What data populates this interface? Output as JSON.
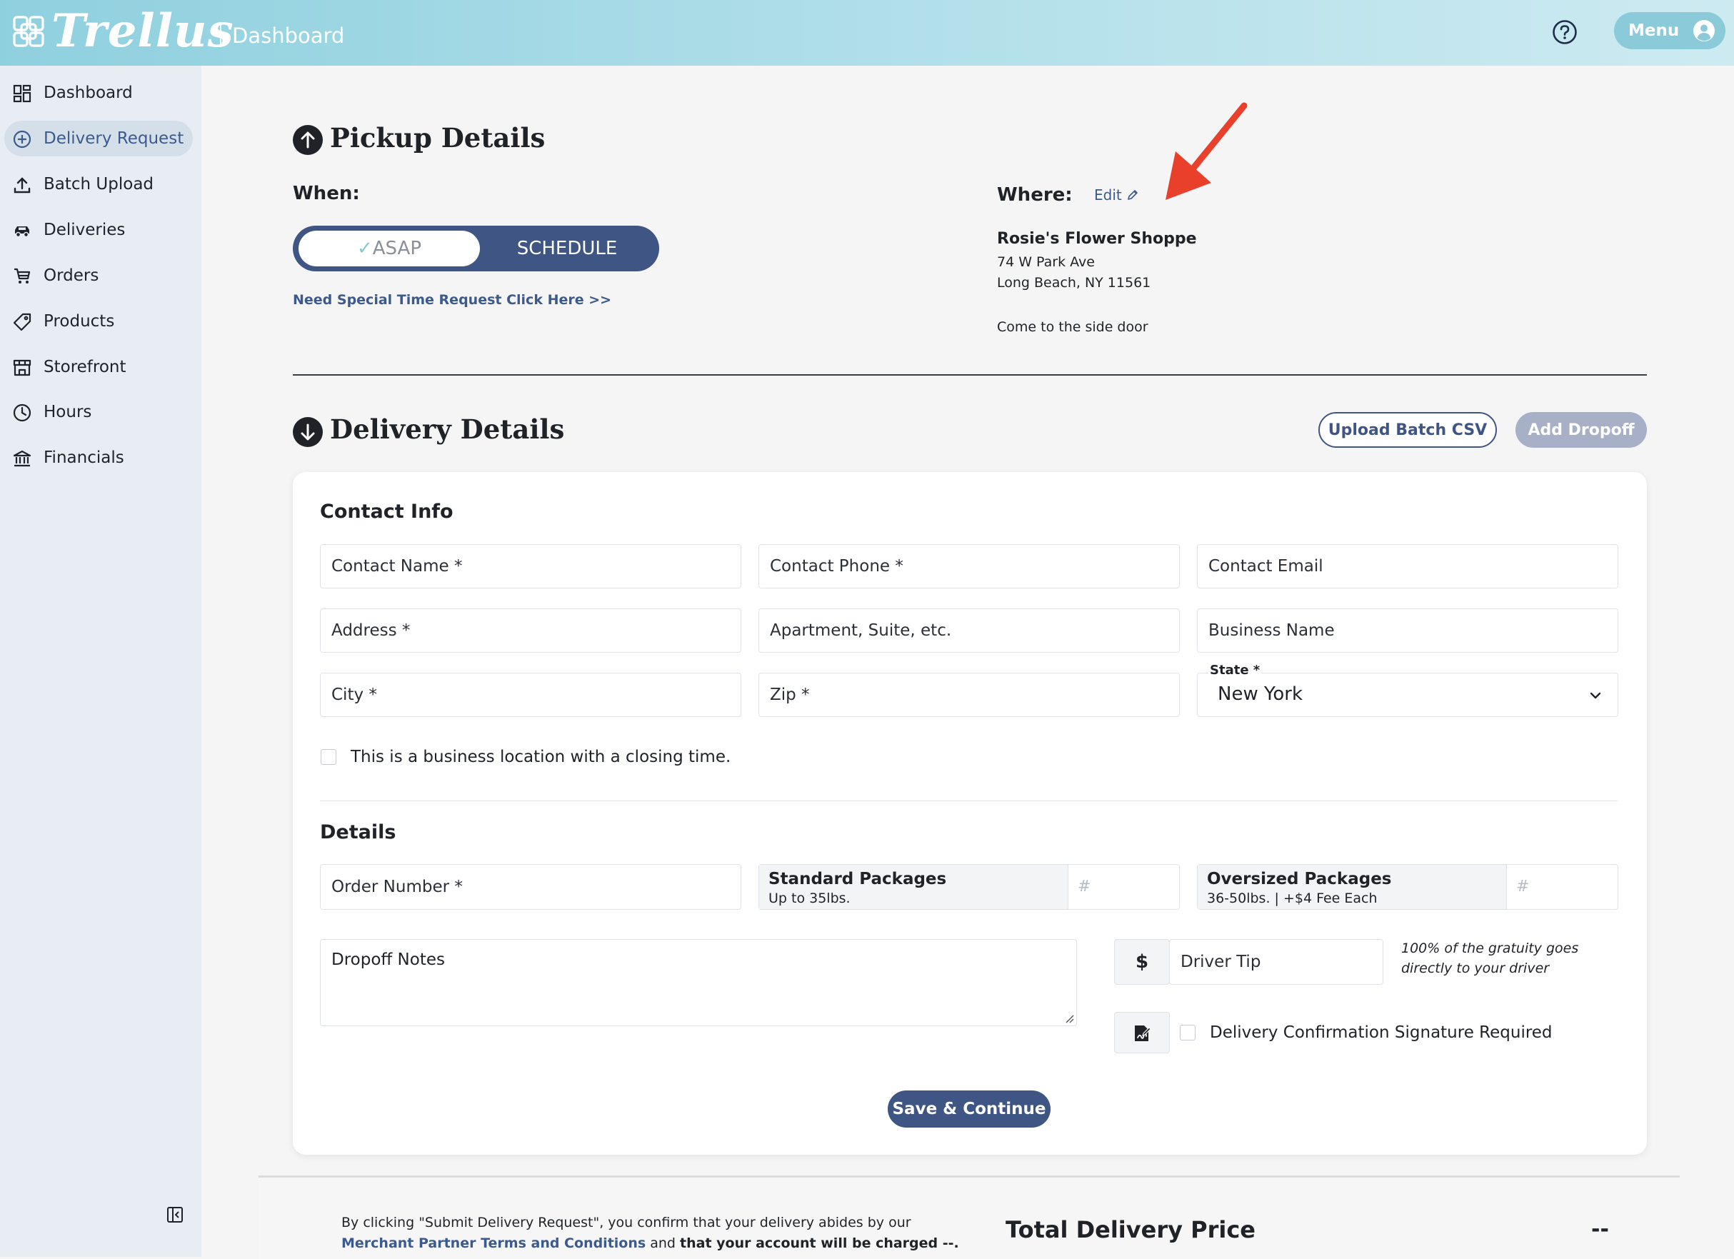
{
  "header": {
    "brand": "Trellus",
    "title": "Dashboard",
    "menu_label": "Menu",
    "help_icon": "help-circle-icon",
    "avatar_icon": "user-circle-icon"
  },
  "sidebar": {
    "items": [
      {
        "label": "Dashboard",
        "icon": "grid-icon",
        "active": false
      },
      {
        "label": "Delivery Request",
        "icon": "plus-circle-icon",
        "active": true
      },
      {
        "label": "Batch Upload",
        "icon": "upload-icon",
        "active": false
      },
      {
        "label": "Deliveries",
        "icon": "car-icon",
        "active": false
      },
      {
        "label": "Orders",
        "icon": "cart-icon",
        "active": false
      },
      {
        "label": "Products",
        "icon": "tag-icon",
        "active": false
      },
      {
        "label": "Storefront",
        "icon": "store-icon",
        "active": false
      },
      {
        "label": "Hours",
        "icon": "clock-icon",
        "active": false
      },
      {
        "label": "Financials",
        "icon": "bank-icon",
        "active": false
      }
    ]
  },
  "pickup": {
    "title": "Pickup Details",
    "when_label": "When:",
    "asap_check": "✓",
    "asap_label": "ASAP",
    "schedule_label": "SCHEDULE",
    "special_link": "Need Special Time Request Click Here >>",
    "where_label": "Where:",
    "edit_label": "Edit",
    "location": {
      "name": "Rosie's Flower Shoppe",
      "street": "74 W Park Ave",
      "city_line": "Long Beach, NY 11561",
      "note": "Come to the side door"
    }
  },
  "delivery": {
    "title": "Delivery Details",
    "upload_batch_label": "Upload Batch CSV",
    "add_dropoff_label": "Add Dropoff",
    "contact_info_title": "Contact Info",
    "contact_name": "Contact Name *",
    "contact_phone": "Contact Phone *",
    "contact_email": "Contact Email",
    "address": "Address *",
    "apartment": "Apartment, Suite, etc.",
    "business_name": "Business Name",
    "city": "City *",
    "zip": "Zip *",
    "state_label": "State *",
    "state_value": "New York",
    "closing_time_label": "This is a business location with a closing time.",
    "details_title": "Details",
    "order_number": "Order Number *",
    "standard_title": "Standard Packages",
    "standard_sub": "Up to 35lbs.",
    "oversized_title": "Oversized Packages",
    "oversized_sub": "36-50lbs. | +$4 Fee Each",
    "count_placeholder": "#",
    "dropoff_notes": "Dropoff Notes",
    "currency_symbol": "$",
    "driver_tip": "Driver Tip",
    "tip_note_line1": "100% of the gratuity goes",
    "tip_note_line2": "directly to your driver",
    "signature_label": "Delivery Confirmation Signature Required",
    "save_label": "Save & Continue"
  },
  "footer": {
    "terms_prefix": "By clicking \"Submit Delivery Request\", you confirm that your delivery abides by our",
    "terms_link": "Merchant Partner Terms and Conditions",
    "terms_and": "and",
    "terms_charged": "that your account will be charged --.",
    "total_label": "Total Delivery Price",
    "total_value": "--"
  },
  "colors": {
    "header_bg": "#8fd0df",
    "primary": "#3f5583",
    "link": "#3c5a8c",
    "sidebar_bg": "#e7edf2",
    "annotation_arrow": "#e8402b"
  }
}
